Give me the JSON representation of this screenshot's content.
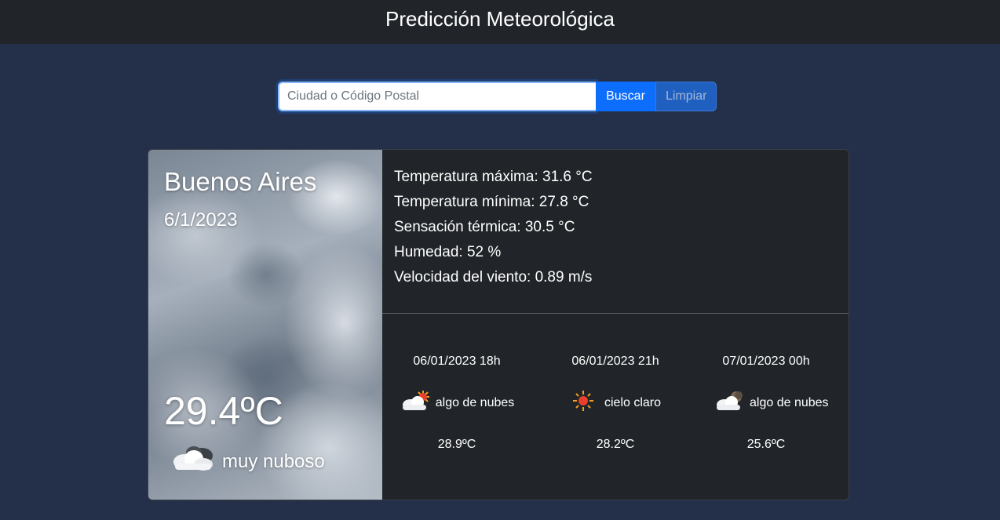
{
  "header": {
    "title": "Predicción Meteorológica"
  },
  "search": {
    "placeholder": "Ciudad o Código Postal",
    "value": "",
    "search_label": "Buscar",
    "clear_label": "Limpiar"
  },
  "current": {
    "city": "Buenos Aires",
    "date": "6/1/2023",
    "temperature": "29.4ºC",
    "condition": "muy nuboso",
    "condition_icon": "broken-clouds-icon"
  },
  "details": {
    "max_temp": "Temperatura máxima: 31.6 °C",
    "min_temp": "Temperatura mínima: 27.8 °C",
    "feels_like": "Sensación térmica: 30.5 °C",
    "humidity": "Humedad: 52 %",
    "wind": "Velocidad del viento: 0.89 m/s"
  },
  "forecast": [
    {
      "datetime": "06/01/2023 18h",
      "condition": "algo de nubes",
      "icon": "few-clouds-day-icon",
      "temp": "28.9ºC"
    },
    {
      "datetime": "06/01/2023 21h",
      "condition": "cielo claro",
      "icon": "clear-sky-icon",
      "temp": "28.2ºC"
    },
    {
      "datetime": "07/01/2023 00h",
      "condition": "algo de nubes",
      "icon": "few-clouds-night-icon",
      "temp": "25.6ºC"
    }
  ],
  "colors": {
    "page_bg": "#243049",
    "header_bg": "#212529",
    "card_bg": "#212529",
    "primary": "#0d6efd"
  }
}
